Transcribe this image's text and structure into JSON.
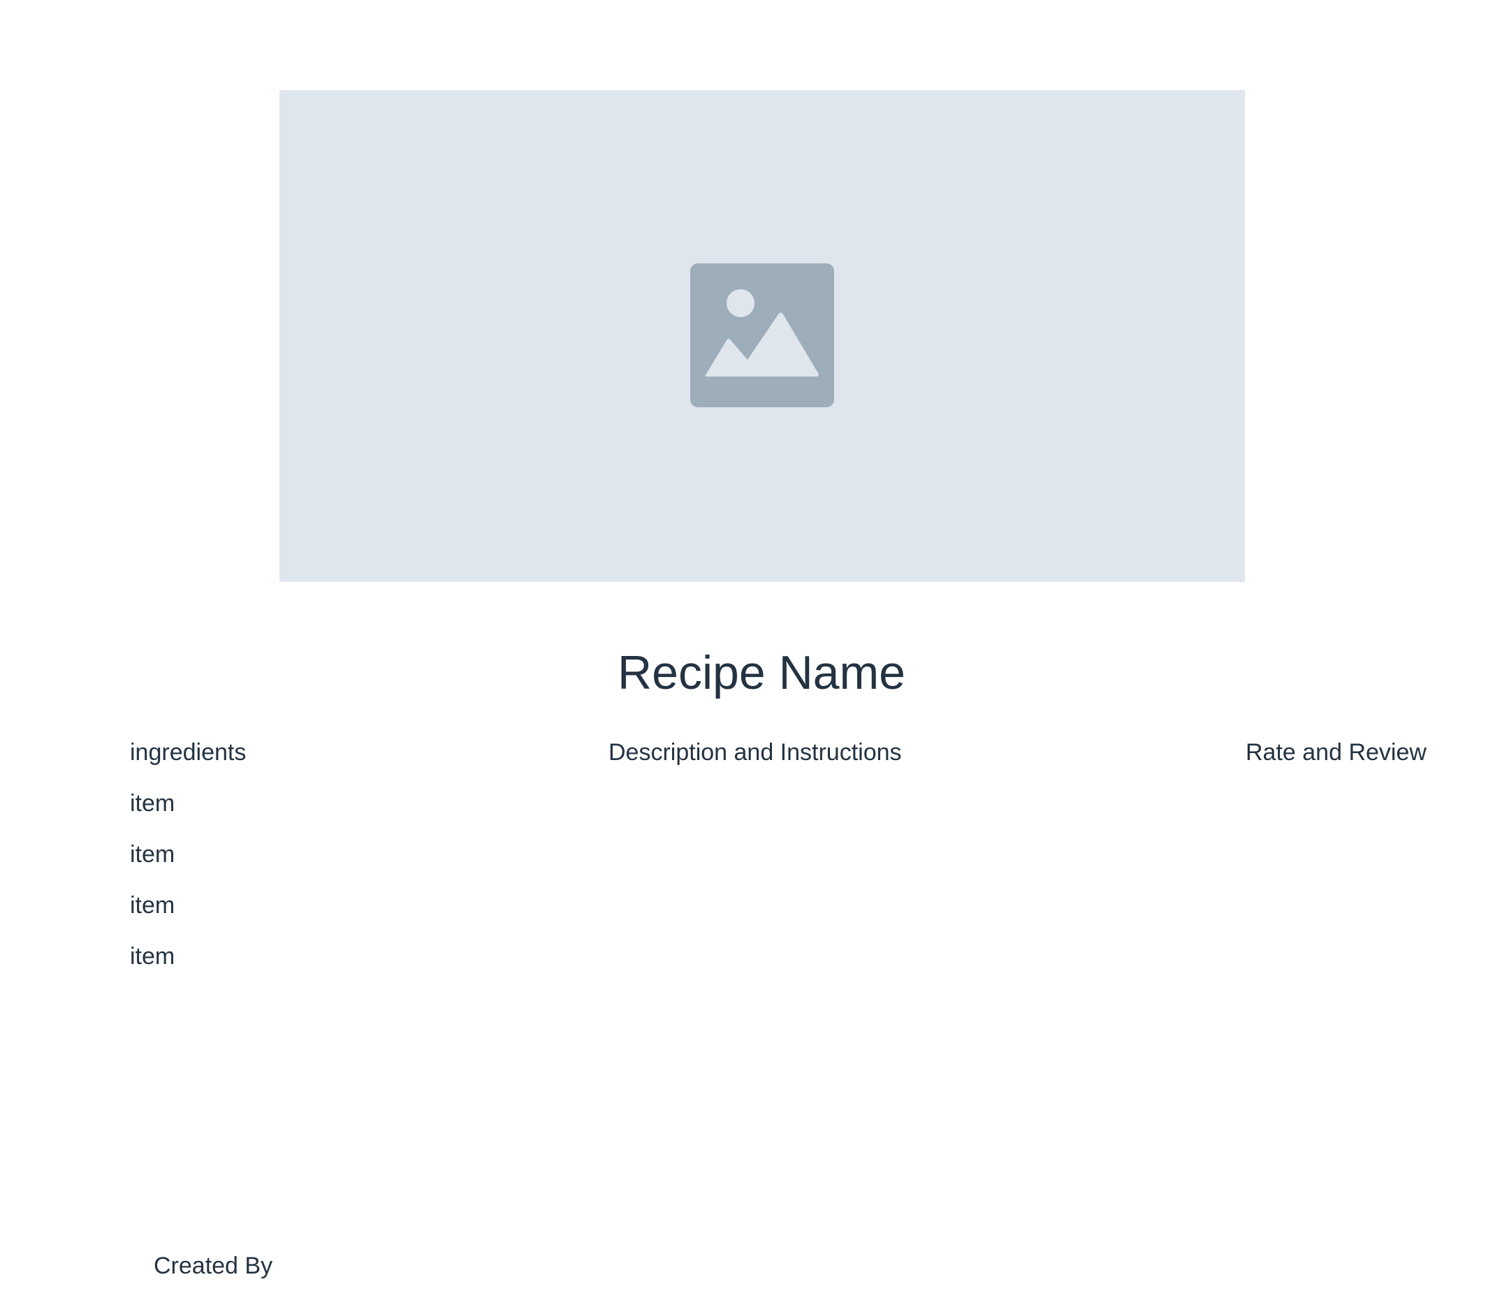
{
  "colors": {
    "text": "#243342",
    "image_placeholder_bg": "#e0e6ee",
    "image_icon": "#9eadba",
    "page_bg": "#ffffff"
  },
  "hero": {
    "icon": "image-placeholder-icon"
  },
  "recipe": {
    "title": "Recipe Name"
  },
  "sections": {
    "ingredients_heading": "ingredients",
    "description_heading": "Description and Instructions",
    "review_heading": "Rate and Review"
  },
  "ingredients": {
    "items": [
      "item",
      "item",
      "item",
      "item"
    ]
  },
  "footer": {
    "created_by": "Created By"
  }
}
